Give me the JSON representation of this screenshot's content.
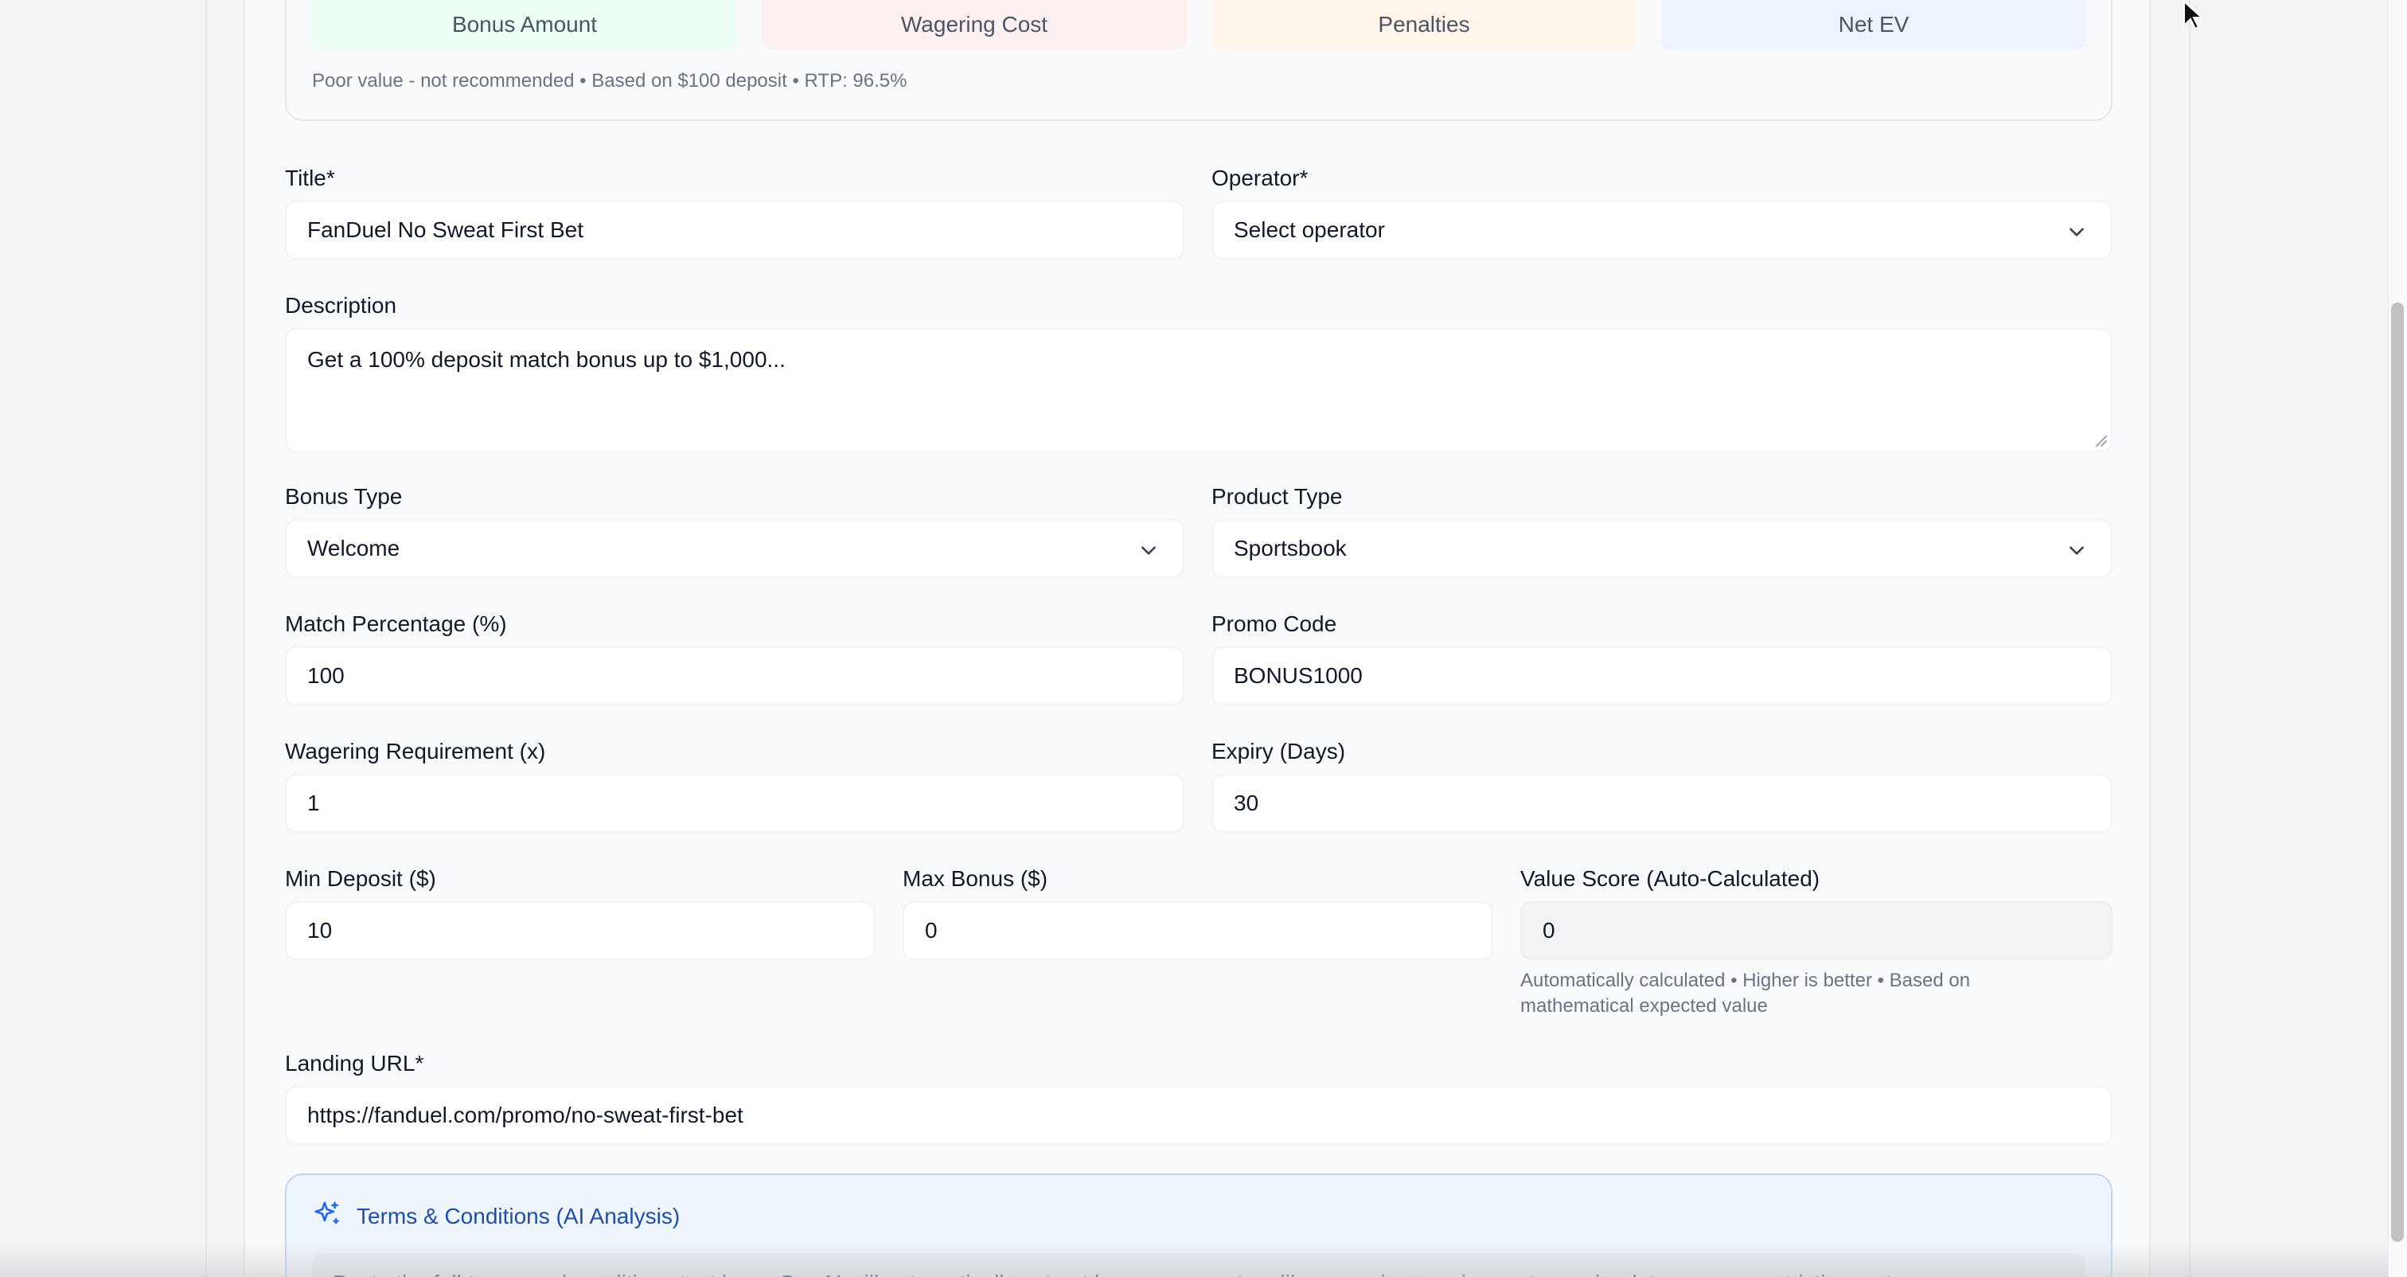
{
  "ev_summary": {
    "bonus_amount": "Bonus Amount",
    "wagering_cost": "Wagering Cost",
    "penalties": "Penalties",
    "net_ev": "Net EV",
    "note": "Poor value - not recommended • Based on $100 deposit • RTP: 96.5%"
  },
  "form": {
    "title": {
      "label": "Title*",
      "value": "FanDuel No Sweat First Bet"
    },
    "operator": {
      "label": "Operator*",
      "value": "Select operator"
    },
    "description": {
      "label": "Description",
      "value": "Get a 100% deposit match bonus up to $1,000..."
    },
    "bonus_type": {
      "label": "Bonus Type",
      "value": "Welcome"
    },
    "product_type": {
      "label": "Product Type",
      "value": "Sportsbook"
    },
    "match_percentage": {
      "label": "Match Percentage (%)",
      "value": "100"
    },
    "promo_code": {
      "label": "Promo Code",
      "value": "BONUS1000"
    },
    "wagering_requirement": {
      "label": "Wagering Requirement (x)",
      "value": "1"
    },
    "expiry_days": {
      "label": "Expiry (Days)",
      "value": "30"
    },
    "min_deposit": {
      "label": "Min Deposit ($)",
      "value": "10"
    },
    "max_bonus": {
      "label": "Max Bonus ($)",
      "value": "0"
    },
    "value_score": {
      "label": "Value Score (Auto-Calculated)",
      "value": "0",
      "hint": "Automatically calculated • Higher is better • Based on mathematical expected value"
    },
    "landing_url": {
      "label": "Landing URL*",
      "value": "https://fanduel.com/promo/no-sweat-first-bet"
    }
  },
  "terms": {
    "title": "Terms & Conditions (AI Analysis)",
    "placeholder": "Paste the full terms and conditions text here. Our AI will automatically extract bonus parameters like wagering requirements, expiry dates, game restrictions, etc."
  },
  "colors": {
    "accent_blue": "#2563eb",
    "bonus_green_bg": "#ecfdf3",
    "wager_red_bg": "#fdf0f0",
    "penalty_orange_bg": "#fff5eb",
    "net_ev_blue_bg": "#eef4ff"
  }
}
